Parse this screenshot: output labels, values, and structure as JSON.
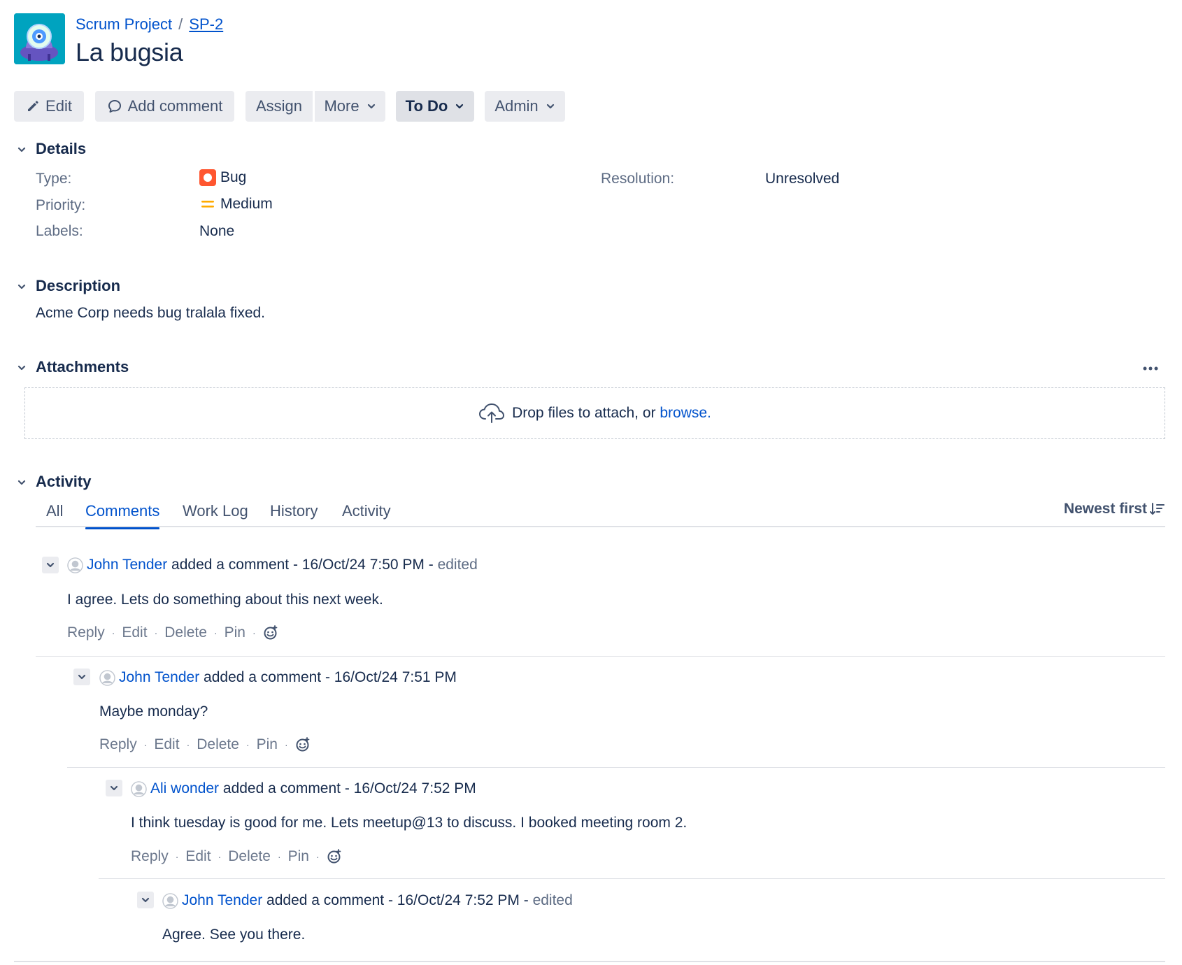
{
  "header": {
    "project_name": "Scrum Project",
    "separator": "/",
    "issue_key": "SP-2",
    "title": "La bugsia"
  },
  "toolbar": {
    "edit": "Edit",
    "add_comment": "Add comment",
    "assign": "Assign",
    "more": "More",
    "status": "To Do",
    "admin": "Admin"
  },
  "details": {
    "heading": "Details",
    "type_label": "Type:",
    "type_value": "Bug",
    "priority_label": "Priority:",
    "priority_value": "Medium",
    "labels_label": "Labels:",
    "labels_value": "None",
    "resolution_label": "Resolution:",
    "resolution_value": "Unresolved"
  },
  "description": {
    "heading": "Description",
    "text": "Acme Corp needs bug tralala fixed."
  },
  "attachments": {
    "heading": "Attachments",
    "drop_text": "Drop files to attach, or ",
    "browse_link": "browse."
  },
  "activity": {
    "heading": "Activity",
    "tabs": [
      "All",
      "Comments",
      "Work Log",
      "History",
      "Activity"
    ],
    "active_tab": "Comments",
    "sort_label": "Newest first"
  },
  "comments": [
    {
      "author": "John Tender",
      "action": " added a comment - 16/Oct/24 7:50 PM - ",
      "edited": "edited",
      "body": "I agree. Lets do something about this next week."
    },
    {
      "author": "John Tender",
      "action": " added a comment - 16/Oct/24 7:51 PM",
      "edited": "",
      "body": "Maybe monday?"
    },
    {
      "author": "Ali wonder",
      "action": " added a comment - 16/Oct/24 7:52 PM",
      "edited": "",
      "body": "I think tuesday is good for me. Lets meetup@13 to discuss. I booked meeting room 2."
    },
    {
      "author": "John Tender",
      "action": " added a comment - 16/Oct/24 7:52 PM - ",
      "edited": "edited",
      "body": "Agree. See you there."
    }
  ],
  "comment_actions": {
    "reply": "Reply",
    "edit": "Edit",
    "delete": "Delete",
    "pin": "Pin",
    "separator": "·"
  },
  "colors": {
    "link": "#0052cc",
    "bug": "#ff5630",
    "priority_medium": "#ffab00",
    "project_avatar": "#00a3bf"
  },
  "icons": [
    "pencil-icon",
    "comment-icon",
    "chevron-down-icon",
    "bug-icon",
    "priority-medium-icon",
    "cloud-upload-icon",
    "more-dots-icon",
    "sort-icon",
    "user-avatar-icon",
    "emoji-reaction-icon"
  ]
}
